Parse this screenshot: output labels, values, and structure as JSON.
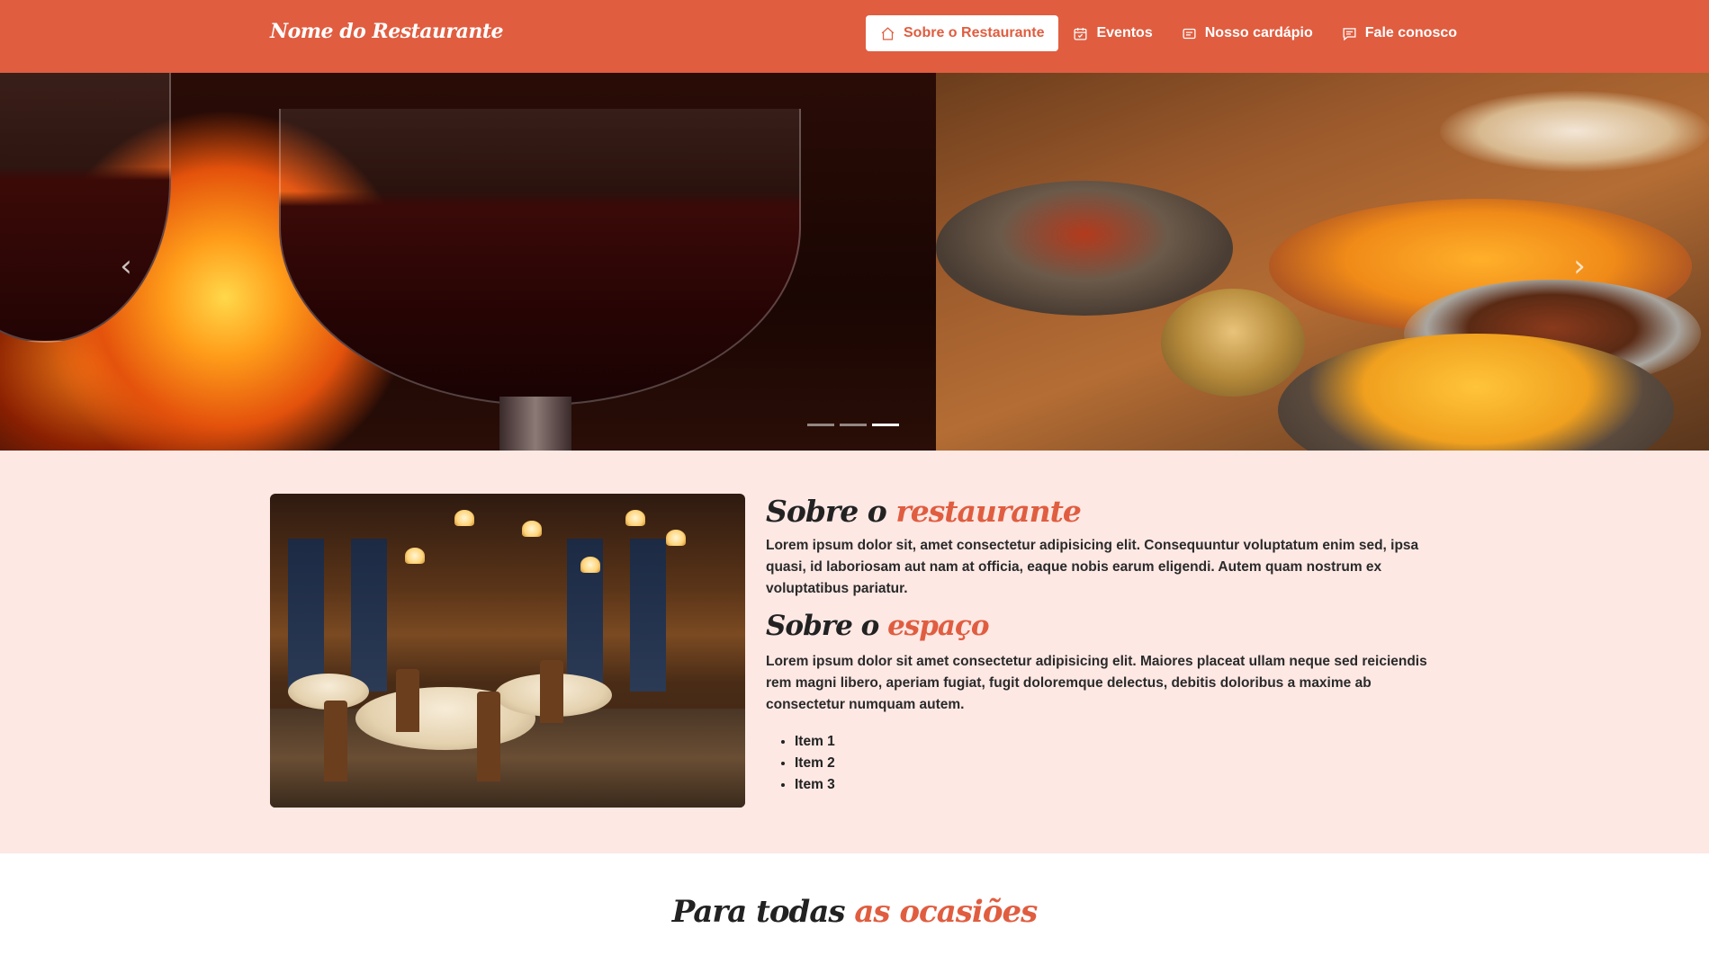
{
  "brand": {
    "name": "Nome do Restaurante"
  },
  "nav": {
    "items": [
      {
        "label": "Sobre o Restaurante",
        "icon": "home-icon",
        "active": true
      },
      {
        "label": "Eventos",
        "icon": "calendar-icon",
        "active": false
      },
      {
        "label": "Nosso cardápio",
        "icon": "menu-card-icon",
        "active": false
      },
      {
        "label": "Fale conosco",
        "icon": "chat-icon",
        "active": false
      }
    ]
  },
  "carousel": {
    "prev_icon": "chevron-left-icon",
    "next_icon": "chevron-right-icon",
    "indicator_count": 3,
    "active_indicator": 3
  },
  "about": {
    "title1_prefix": "Sobre o",
    "title1_accent": "restaurante",
    "text1": "Lorem ipsum dolor sit, amet consectetur adipisicing elit. Consequuntur voluptatum enim sed, ipsa quasi, id laboriosam aut nam at officia, eaque nobis earum eligendi. Autem quam nostrum ex voluptatibus pariatur.",
    "title2_prefix": "Sobre o",
    "title2_accent": "espaço",
    "text2": "Lorem ipsum dolor sit amet consectetur adipisicing elit. Maiores placeat ullam neque sed reiciendis rem magni libero, aperiam fugiat, fugit doloremque delectus, debitis doloribus a maxime ab consectetur numquam autem.",
    "items": [
      "Item 1",
      "Item 2",
      "Item 3"
    ]
  },
  "occasions": {
    "title_prefix": "Para todas",
    "title_accent": "as ocasiões"
  },
  "colors": {
    "primary": "#e05d40",
    "about_bg": "#fde8e4",
    "text": "#222222"
  }
}
